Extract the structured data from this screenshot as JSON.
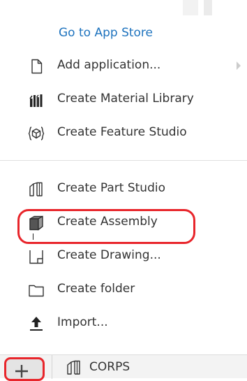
{
  "menu": {
    "store_link": "Go to App Store",
    "items_top": [
      {
        "label": "Add application...",
        "icon": "document-icon",
        "submenu": true
      },
      {
        "label": "Create Material Library",
        "icon": "material-library-icon"
      },
      {
        "label": "Create Feature Studio",
        "icon": "feature-studio-icon"
      }
    ],
    "items_bottom": [
      {
        "label": "Create Part Studio",
        "icon": "part-studio-icon"
      },
      {
        "label": "Create Assembly",
        "icon": "assembly-icon"
      },
      {
        "label": "Create Drawing...",
        "icon": "drawing-icon"
      },
      {
        "label": "Create folder",
        "icon": "folder-icon"
      },
      {
        "label": "Import...",
        "icon": "import-icon"
      }
    ]
  },
  "bottom_bar": {
    "add_icon": "plus-icon",
    "tab": {
      "label": "CORPS",
      "icon": "part-studio-icon"
    }
  },
  "colors": {
    "link": "#1e73be",
    "highlight": "#e8252b",
    "text": "#333333"
  }
}
